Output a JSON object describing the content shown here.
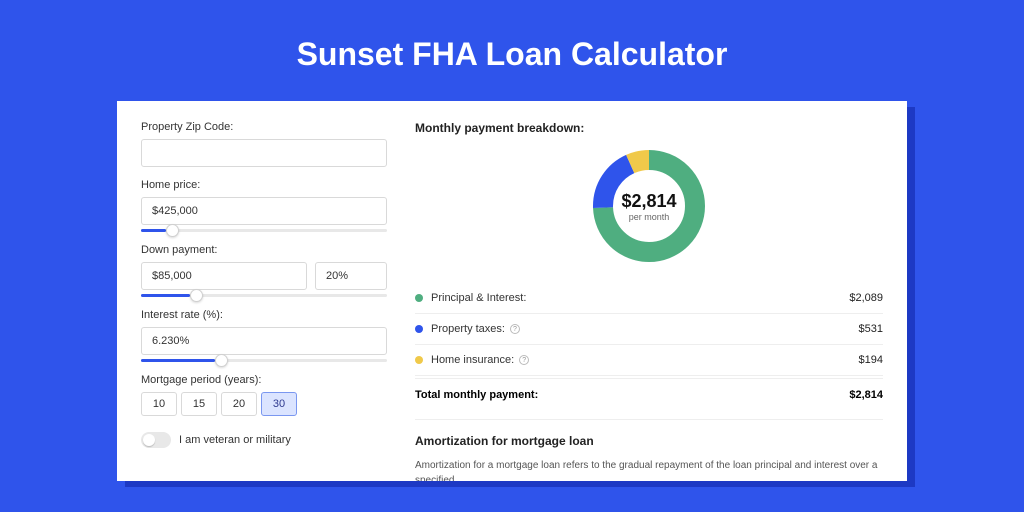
{
  "title": "Sunset FHA Loan Calculator",
  "form": {
    "zip_label": "Property Zip Code:",
    "zip_value": "",
    "home_price_label": "Home price:",
    "home_price_value": "$425,000",
    "home_price_pct": 10,
    "down_payment_label": "Down payment:",
    "down_payment_value": "$85,000",
    "down_payment_pct_value": "20%",
    "down_payment_slider_pct": 20,
    "interest_label": "Interest rate (%):",
    "interest_value": "6.230%",
    "interest_slider_pct": 30,
    "period_label": "Mortgage period (years):",
    "periods": [
      "10",
      "15",
      "20",
      "30"
    ],
    "period_selected": "30",
    "veteran_label": "I am veteran or military"
  },
  "breakdown": {
    "title": "Monthly payment breakdown:",
    "center_amount": "$2,814",
    "center_sub": "per month",
    "items": [
      {
        "label": "Principal & Interest:",
        "value": "$2,089",
        "has_info": false
      },
      {
        "label": "Property taxes:",
        "value": "$531",
        "has_info": true
      },
      {
        "label": "Home insurance:",
        "value": "$194",
        "has_info": true
      }
    ],
    "total_label": "Total monthly payment:",
    "total_value": "$2,814"
  },
  "chart_data": {
    "type": "pie",
    "title": "Monthly payment breakdown",
    "series": [
      {
        "name": "Principal & Interest",
        "value": 2089,
        "color": "#4fae80"
      },
      {
        "name": "Property taxes",
        "value": 531,
        "color": "#2f54eb"
      },
      {
        "name": "Home insurance",
        "value": 194,
        "color": "#f0c94a"
      }
    ],
    "total": 2814,
    "center_label": "$2,814 per month"
  },
  "amortization": {
    "title": "Amortization for mortgage loan",
    "body": "Amortization for a mortgage loan refers to the gradual repayment of the loan principal and interest over a specified"
  }
}
